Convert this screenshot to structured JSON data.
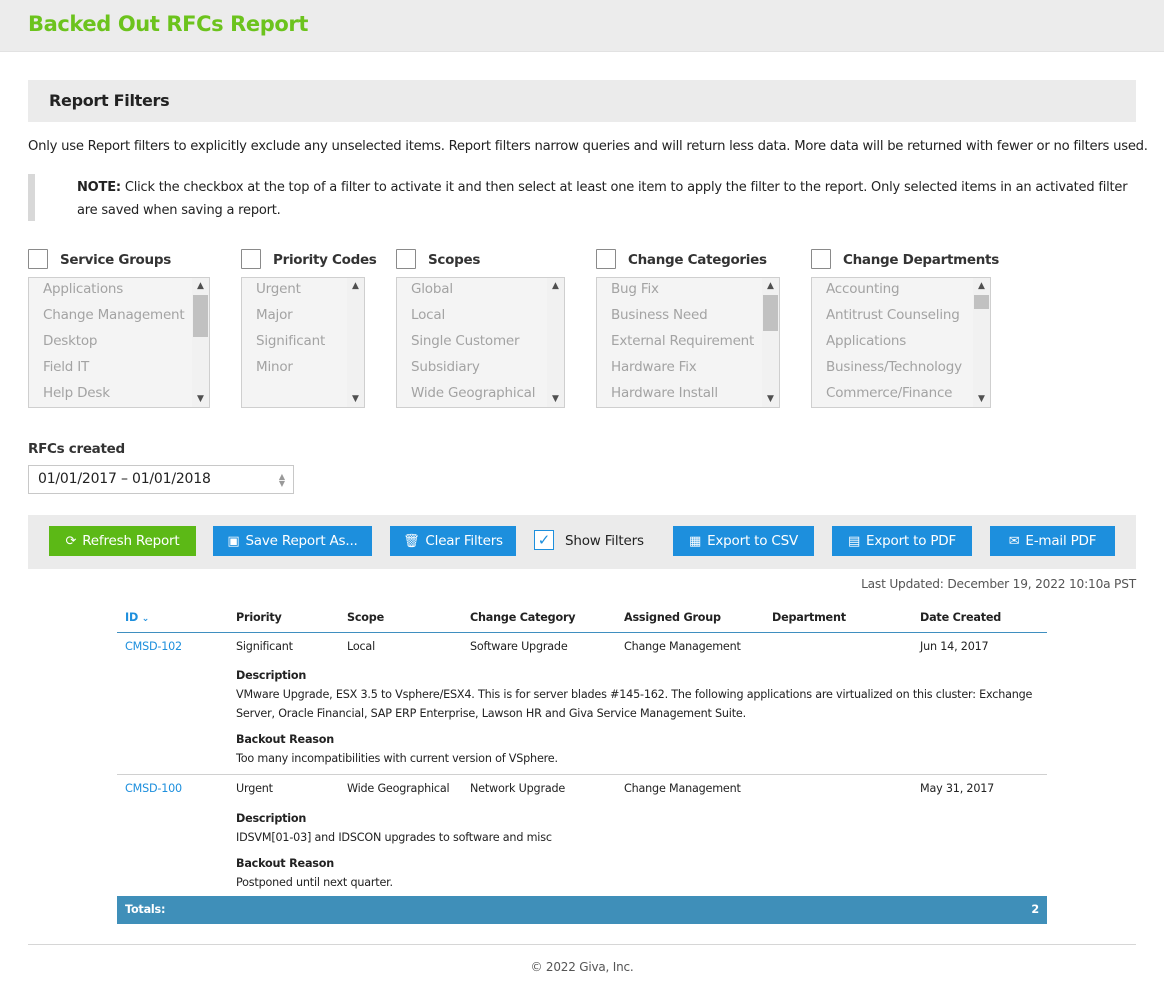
{
  "header": {
    "title": "Backed Out RFCs Report"
  },
  "filters": {
    "heading": "Report Filters",
    "intro": "Only use Report filters to explicitly exclude any unselected items. Report filters narrow queries and will return less data. More data will be returned with fewer or no filters used.",
    "note_label": "NOTE:",
    "note_text": " Click the checkbox at the top of a filter to activate it and then select at least one item to apply the filter to the report. Only selected items in an activated filter are saved when saving a report.",
    "groups": [
      {
        "label": "Service Groups",
        "checked": false,
        "items": [
          "Applications",
          "Change Management",
          "Desktop",
          "Field IT",
          "Help Desk"
        ]
      },
      {
        "label": "Priority Codes",
        "checked": false,
        "items": [
          "Urgent",
          "Major",
          "Significant",
          "Minor"
        ]
      },
      {
        "label": "Scopes",
        "checked": false,
        "items": [
          "Global",
          "Local",
          "Single Customer",
          "Subsidiary",
          "Wide Geographical"
        ]
      },
      {
        "label": "Change Categories",
        "checked": false,
        "items": [
          "Bug Fix",
          "Business Need",
          "External Requirement",
          "Hardware Fix",
          "Hardware Install"
        ]
      },
      {
        "label": "Change Departments",
        "checked": false,
        "items": [
          "Accounting",
          "Antitrust Counseling",
          "Applications",
          "Business/Technology",
          "Commerce/Finance"
        ]
      }
    ],
    "rfcs_created_label": "RFCs created",
    "rfcs_created_value": "01/01/2017 – 01/01/2018"
  },
  "toolbar": {
    "refresh": "Refresh Report",
    "save": "Save Report As...",
    "clear": "Clear Filters",
    "show_filters": "Show Filters",
    "show_filters_checked": true,
    "export_csv": "Export to CSV",
    "export_pdf": "Export to PDF",
    "email_pdf": "E-mail PDF"
  },
  "last_updated": "Last Updated: December 19, 2022 10:10a PST",
  "table": {
    "columns": [
      "ID",
      "Priority",
      "Scope",
      "Change Category",
      "Assigned Group",
      "Department",
      "Date Created"
    ],
    "sort_column": "ID",
    "description_label": "Description",
    "backout_label": "Backout Reason",
    "rows": [
      {
        "id": "CMSD-102",
        "priority": "Significant",
        "scope": "Local",
        "category": "Software Upgrade",
        "group": "Change Management",
        "department": "",
        "date": "Jun 14, 2017",
        "description": "VMware Upgrade, ESX 3.5 to Vsphere/ESX4. This is for server blades #145-162. The following applications are virtualized on this cluster: Exchange Server, Oracle Financial, SAP ERP Enterprise, Lawson HR and Giva Service Management Suite.",
        "backout_reason": "Too many incompatibilities with current version of VSphere."
      },
      {
        "id": "CMSD-100",
        "priority": "Urgent",
        "scope": "Wide Geographical",
        "category": "Network Upgrade",
        "group": "Change Management",
        "department": "",
        "date": "May 31, 2017",
        "description": "IDSVM[01-03] and IDSCON upgrades to software and misc",
        "backout_reason": "Postponed until next quarter."
      }
    ],
    "totals_label": "Totals:",
    "totals_value": "2"
  },
  "footer": "© 2022 Giva, Inc.",
  "colors": {
    "accent_green": "#6cc31d",
    "button_green": "#5cb916",
    "button_blue": "#1d8fdd",
    "totals_bar": "#3f8fb9"
  }
}
